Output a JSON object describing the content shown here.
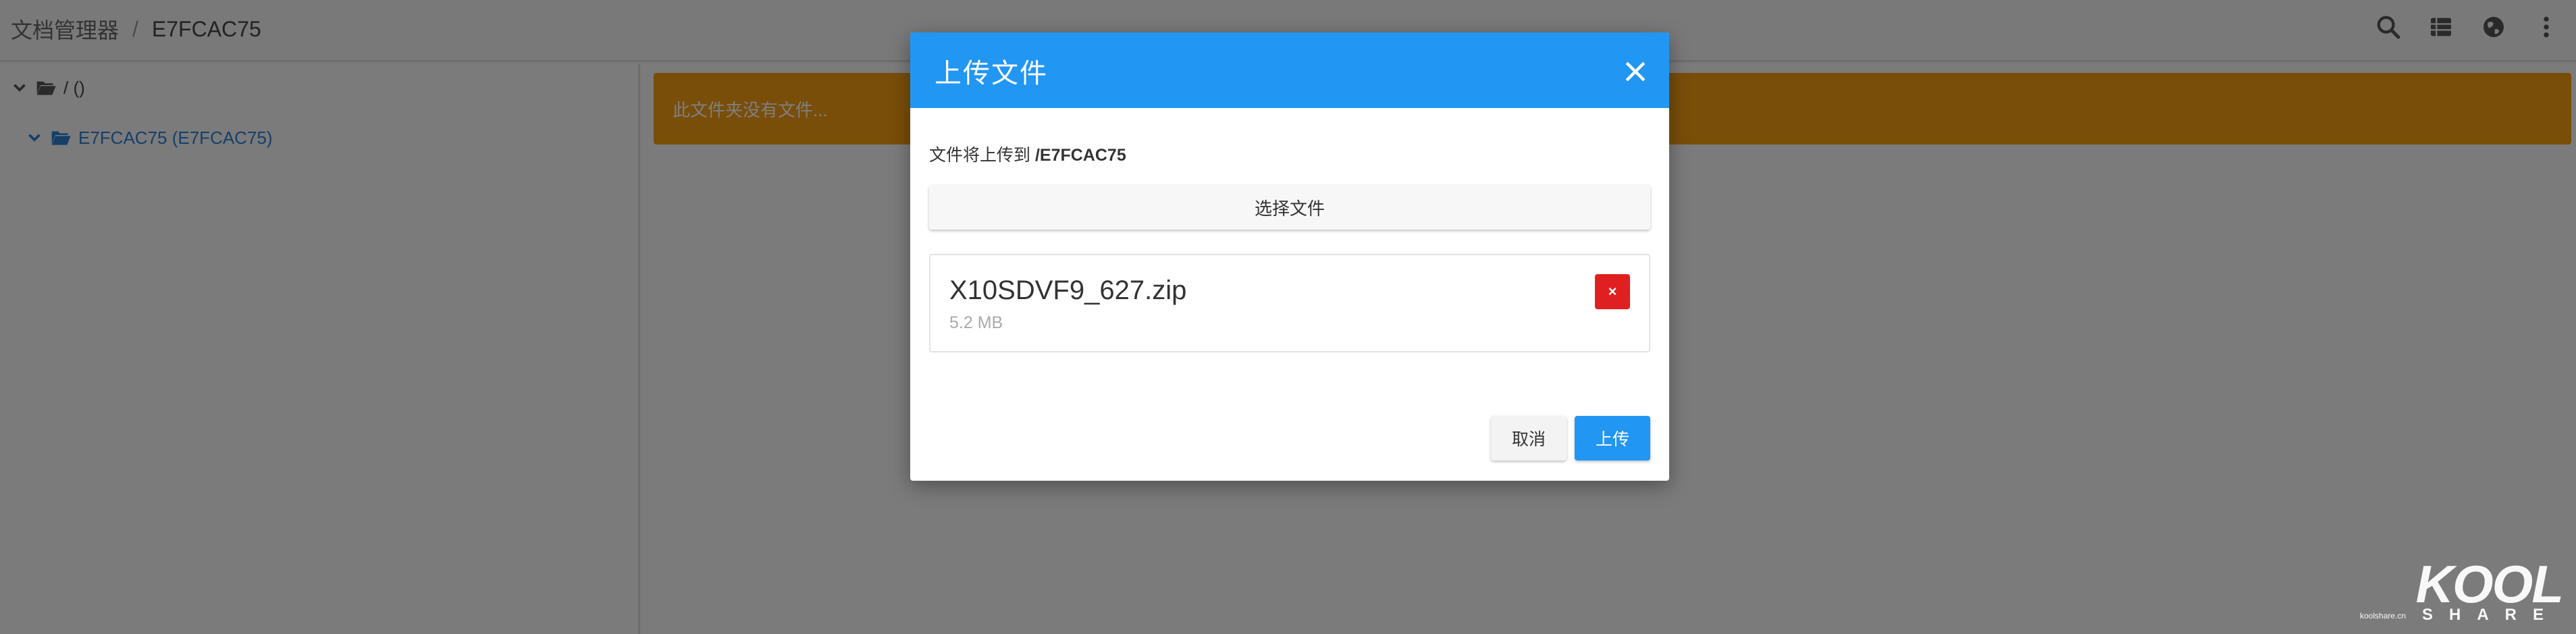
{
  "header": {
    "root_label": "文档管理器",
    "separator": "/",
    "current": "E7FCAC75"
  },
  "toolbar": {
    "icons": [
      "search-icon",
      "list-view-icon",
      "globe-icon",
      "more-vert-icon"
    ]
  },
  "sidebar": {
    "root_label": "/ ()",
    "child_label": "E7FCAC75 (E7FCAC75)"
  },
  "main": {
    "alert_text": "此文件夹没有文件..."
  },
  "modal": {
    "title": "上传文件",
    "target_prefix": "文件将上传到 ",
    "target_path": "/E7FCAC75",
    "choose_label": "选择文件",
    "file": {
      "name": "X10SDVF9_627.zip",
      "size": "5.2 MB",
      "remove_label": "×"
    },
    "cancel_label": "取消",
    "upload_label": "上传"
  },
  "watermark": {
    "brand": "KOOL",
    "sub": "SHARE",
    "site": "koolshare.cn"
  },
  "colors": {
    "primary": "#2196f3",
    "warning": "#f39c12",
    "danger": "#e02020",
    "link": "#2a7fd2"
  }
}
